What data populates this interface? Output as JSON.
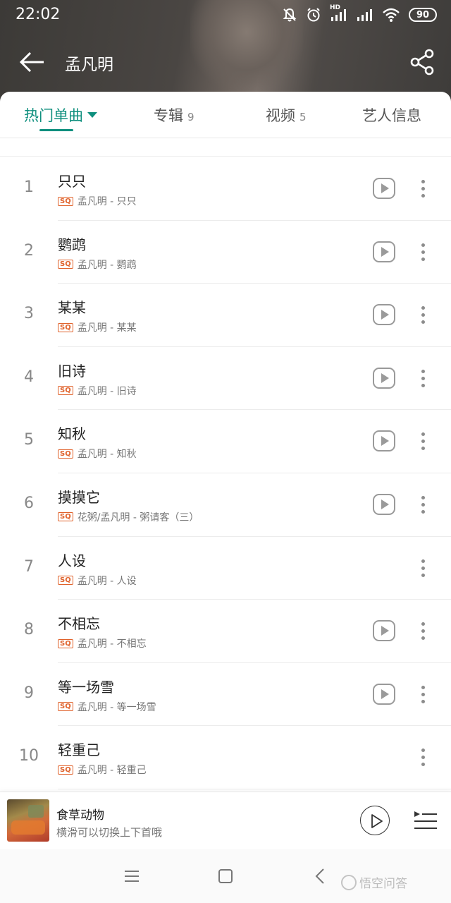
{
  "status_bar": {
    "time": "22:02",
    "network_label": "HD",
    "battery": "90"
  },
  "header": {
    "title": "孟凡明"
  },
  "tabs": [
    {
      "label": "热门单曲",
      "count": "",
      "active": true
    },
    {
      "label": "专辑",
      "count": "9",
      "active": false
    },
    {
      "label": "视频",
      "count": "5",
      "active": false
    },
    {
      "label": "艺人信息",
      "count": "",
      "active": false
    }
  ],
  "quality_badge": "SQ",
  "songs": [
    {
      "index": "1",
      "title": "只只",
      "meta": "孟凡明 - 只只",
      "has_mv": true
    },
    {
      "index": "2",
      "title": "鹦鹉",
      "meta": "孟凡明 - 鹦鹉",
      "has_mv": true
    },
    {
      "index": "3",
      "title": "某某",
      "meta": "孟凡明 - 某某",
      "has_mv": true
    },
    {
      "index": "4",
      "title": "旧诗",
      "meta": "孟凡明 - 旧诗",
      "has_mv": true
    },
    {
      "index": "5",
      "title": "知秋",
      "meta": "孟凡明 - 知秋",
      "has_mv": true
    },
    {
      "index": "6",
      "title": "摸摸它",
      "meta": "花粥/孟凡明 - 粥请客（三）",
      "has_mv": true
    },
    {
      "index": "7",
      "title": "人设",
      "meta": "孟凡明 - 人设",
      "has_mv": false
    },
    {
      "index": "8",
      "title": "不相忘",
      "meta": "孟凡明 - 不相忘",
      "has_mv": true
    },
    {
      "index": "9",
      "title": "等一场雪",
      "meta": "孟凡明 - 等一场雪",
      "has_mv": true
    },
    {
      "index": "10",
      "title": "轻重己",
      "meta": "孟凡明 - 轻重己",
      "has_mv": false
    }
  ],
  "mini_player": {
    "title": "食草动物",
    "subtitle": "横滑可以切换上下首哦"
  },
  "watermark": "悟空问答",
  "colors": {
    "accent": "#0f8f7e",
    "sq_badge": "#e0622b"
  }
}
